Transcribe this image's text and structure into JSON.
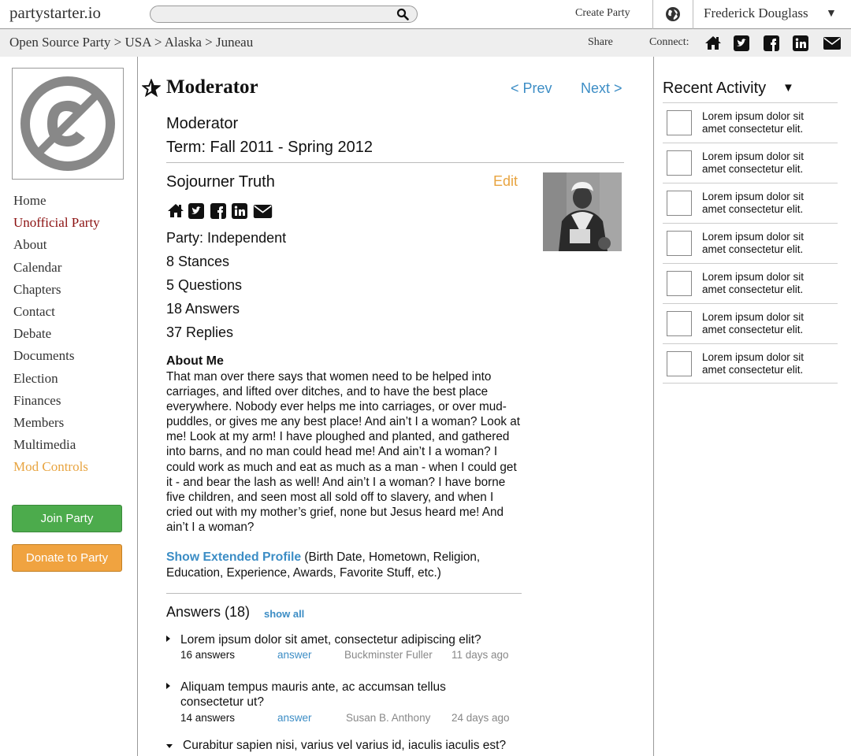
{
  "header": {
    "logo": "partystarter.io",
    "search": {
      "value": "",
      "placeholder": ""
    },
    "create_party": "Create Party",
    "user": "Frederick Douglass"
  },
  "breadcrumb": "Open Source Party > USA > Alaska > Juneau",
  "share_label": "Share",
  "connect_label": "Connect:",
  "sidebar": {
    "nav": [
      {
        "label": "Home"
      },
      {
        "label": "Unofficial Party",
        "state": "active"
      },
      {
        "label": "About"
      },
      {
        "label": "Calendar"
      },
      {
        "label": "Chapters"
      },
      {
        "label": "Contact"
      },
      {
        "label": "Debate"
      },
      {
        "label": "Documents"
      },
      {
        "label": "Election"
      },
      {
        "label": "Finances"
      },
      {
        "label": "Members"
      },
      {
        "label": "Multimedia"
      },
      {
        "label": "Mod Controls",
        "state": "mod"
      }
    ],
    "join_button": "Join Party",
    "donate_button": "Donate to Party"
  },
  "main": {
    "title": "Moderator",
    "prev": "< Prev",
    "next": "Next >",
    "role_name": "Moderator",
    "role_term": "Term: Fall 2011 - Spring 2012",
    "member_name": "Sojourner Truth",
    "edit": "Edit",
    "stats": [
      "Party: Independent",
      "8 Stances",
      "5 Questions",
      "18 Answers",
      "37 Replies"
    ],
    "about_heading": "About Me",
    "about_text": "That man over there says that women need to be helped into carriages, and lifted over ditches, and to have the best place everywhere. Nobody ever helps me into carriages, or over mud-puddles, or gives me any best place! And ain’t I a woman? Look at me! Look at my arm! I have ploughed and planted, and gathered into barns, and no man could head me! And ain’t I a woman? I could work as much and eat as much as a man - when I could get it - and bear the lash as well! And ain’t I a woman? I have borne five children, and seen most all sold off to slavery, and when I cried out with my mother’s grief, none but Jesus heard me! And ain’t I a woman?",
    "extended_link": "Show Extended Profile",
    "extended_rest": " (Birth Date, Hometown, Religion, Education, Experience,  Awards, Favorite Stuff, etc.)",
    "answers_heading": "Answers (18)",
    "show_all": "show all",
    "questions": [
      {
        "text": "Lorem ipsum dolor sit amet, consectetur adipiscing elit?",
        "count": "16 answers",
        "action": "answer",
        "author": "Buckminster Fuller",
        "time": "11 days ago",
        "expanded": false
      },
      {
        "text": "Aliquam tempus mauris ante, ac accumsan tellus consectetur ut?",
        "count": "14 answers",
        "action": "answer",
        "author": "Susan B. Anthony",
        "time": "24 days ago",
        "expanded": false
      },
      {
        "text": "Curabitur sapien nisi, varius vel varius id, iaculis iaculis est?",
        "expanded": true
      }
    ]
  },
  "activity": {
    "title": "Recent Activity",
    "items": [
      "Lorem ipsum dolor sit amet consectetur elit.",
      "Lorem ipsum dolor sit amet consectetur elit.",
      "Lorem ipsum dolor sit amet consectetur elit.",
      "Lorem ipsum dolor sit amet consectetur elit.",
      "Lorem ipsum dolor sit amet consectetur elit.",
      "Lorem ipsum dolor sit amet consectetur elit.",
      "Lorem ipsum dolor sit amet consectetur elit."
    ]
  },
  "colors": {
    "link_blue": "#3c8dc5",
    "accent_orange": "#e8a440",
    "active_red": "#8b1010",
    "join_green": "#4cab4c",
    "donate_orange": "#f0a340"
  }
}
